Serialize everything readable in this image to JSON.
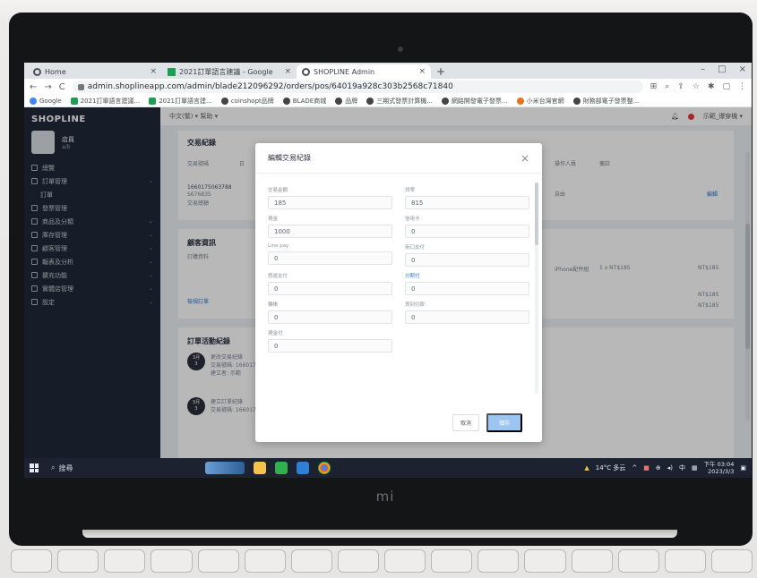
{
  "browser": {
    "tabs": [
      {
        "label": "Home",
        "icon": "globe-icon"
      },
      {
        "label": "2021訂單語言建議 - Google",
        "icon": "sheets-icon"
      },
      {
        "label": "SHOPLINE Admin",
        "icon": "globe-icon"
      }
    ],
    "new_tab": "+",
    "url": "admin.shoplineapp.com/admin/blade212096292/orders/pos/64019a928c303b2568c71840",
    "bookmarks": [
      {
        "label": "Google",
        "icon": "g"
      },
      {
        "label": "2021訂單語言建議...",
        "icon": "sheet"
      },
      {
        "label": "2021訂單語言建...",
        "icon": "sheet"
      },
      {
        "label": "coinshopt品牌",
        "icon": "k"
      },
      {
        "label": "BLADE商城",
        "icon": "k"
      },
      {
        "label": "品牌",
        "icon": "k"
      },
      {
        "label": "三期式發票計算機...",
        "icon": "k"
      },
      {
        "label": "網路開發電子發票...",
        "icon": "k"
      },
      {
        "label": "小米台灣官網",
        "icon": "o"
      },
      {
        "label": "財務部電子發票整...",
        "icon": "k"
      }
    ]
  },
  "app": {
    "logo": "SHOPLINE",
    "store": {
      "name": "店員",
      "sub": "a/b"
    },
    "menu": [
      {
        "label": "總覽",
        "sub": false,
        "chev": false
      },
      {
        "label": "訂單管理",
        "sub": false,
        "chev": true
      },
      {
        "label": "訂單",
        "sub": true,
        "chev": false
      },
      {
        "label": "發票管理",
        "sub": false,
        "chev": false
      },
      {
        "label": "商品及分類",
        "sub": false,
        "chev": true
      },
      {
        "label": "庫存管理",
        "sub": false,
        "chev": true
      },
      {
        "label": "顧客管理",
        "sub": false,
        "chev": true
      },
      {
        "label": "報表及分析",
        "sub": false,
        "chev": true
      },
      {
        "label": "擴充功能",
        "sub": false,
        "chev": true
      },
      {
        "label": "實體店管理",
        "sub": false,
        "chev": true
      },
      {
        "label": "設定",
        "sub": false,
        "chev": true
      }
    ],
    "topbar": {
      "breadcrumb": "中文(繁) ▾   幫助 ▾",
      "user": "示範_爆穿機 ▾"
    },
    "section_transactions": {
      "title": "交易紀錄",
      "col1": "交易號碼",
      "col2": "日",
      "col3": "操作人員",
      "col4": "備註",
      "row_id": "1660175063788",
      "row_sub": "S676835",
      "row_type": "交易總額",
      "row_op": "自由",
      "row_action": "編輯"
    },
    "section_customer": {
      "title": "顧客資訊",
      "label": "訂購資料",
      "link": "檢視訂單",
      "item": "iPhone配件組",
      "qty": "1 x NT$185",
      "price1": "NT$185",
      "price2": "NT$185",
      "price3": "NT$185"
    },
    "section_activity": {
      "title": "訂單活動紀錄",
      "events": [
        {
          "month": "3月",
          "day": "3",
          "line1": "更改交易紀錄",
          "line2": "交易號碼: 1660175...",
          "line3": "建立者: 示範"
        },
        {
          "month": "3月",
          "day": "3",
          "line1": "建立訂單紀錄",
          "line2": "交易號碼: 1660175063788067835"
        }
      ]
    }
  },
  "modal": {
    "title": "編輯交易紀錄",
    "close": "×",
    "fields": [
      {
        "label": "交易金額",
        "value": "185",
        "blue": false
      },
      {
        "label": "找零",
        "value": "815",
        "blue": false
      },
      {
        "label": "現金",
        "value": "1000",
        "blue": false
      },
      {
        "label": "信用卡",
        "value": "0",
        "blue": false
      },
      {
        "label": "Line pay",
        "value": "0",
        "blue": false
      },
      {
        "label": "街口支付",
        "value": "0",
        "blue": false
      },
      {
        "label": "悠遊支付",
        "value": "0",
        "blue": false
      },
      {
        "label": "分期付",
        "value": "0",
        "blue": true
      },
      {
        "label": "轉帳",
        "value": "0",
        "blue": false
      },
      {
        "label": "貨到付款",
        "value": "0",
        "blue": false
      },
      {
        "label": "現金付",
        "value": "0",
        "blue": false
      }
    ],
    "cancel": "取消",
    "save": "儲存"
  },
  "taskbar": {
    "search": "搜尋",
    "weather": "14°C 多云",
    "ime": "中",
    "time": "下午 03:04",
    "date": "2023/3/3"
  },
  "device_brand": "mi"
}
